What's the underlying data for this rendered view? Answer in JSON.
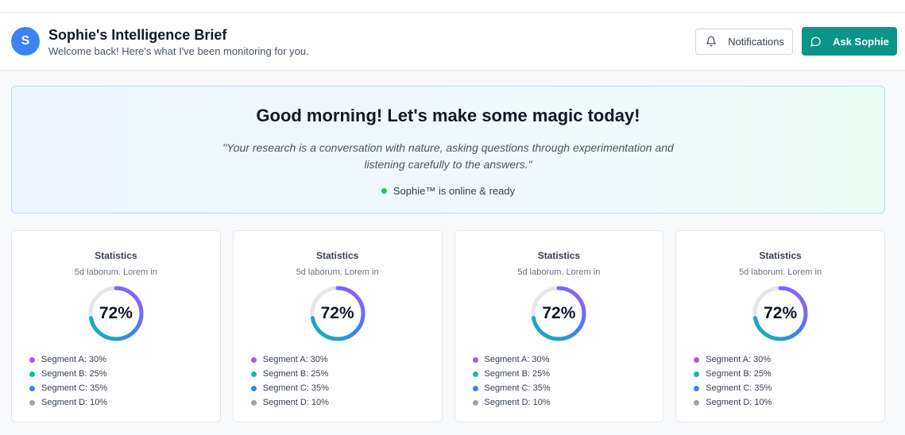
{
  "header": {
    "avatar_initial": "S",
    "title": "Sophie's Intelligence Brief",
    "subtitle": "Welcome back! Here's what I've been monitoring for you.",
    "notifications_label": "Notifications",
    "ask_label": "Ask Sophie"
  },
  "hero": {
    "title": "Good morning! Let's make some magic today!",
    "quote": "\"Your research is a conversation with nature, asking questions through experimentation and listening carefully to the answers.\"",
    "status": "Sophie™ is online & ready"
  },
  "cards": [
    {
      "title": "Statistics",
      "subtitle": "5d laborum. Lorem in",
      "value": "72%",
      "progress": 0.72,
      "legend": [
        {
          "label": "Segment A: 30%",
          "color": "#a855f7"
        },
        {
          "label": "Segment B: 25%",
          "color": "#14b8a6"
        },
        {
          "label": "Segment C: 35%",
          "color": "#3b82f6"
        },
        {
          "label": "Segment D: 10%",
          "color": "#9ca3af"
        }
      ]
    },
    {
      "title": "Statistics",
      "subtitle": "5d laborum. Lorem in",
      "value": "72%",
      "progress": 0.72,
      "legend": [
        {
          "label": "Segment A: 30%",
          "color": "#a855f7"
        },
        {
          "label": "Segment B: 25%",
          "color": "#14b8a6"
        },
        {
          "label": "Segment C: 35%",
          "color": "#3b82f6"
        },
        {
          "label": "Segment D: 10%",
          "color": "#9ca3af"
        }
      ]
    },
    {
      "title": "Statistics",
      "subtitle": "5d laborum. Lorem in",
      "value": "72%",
      "progress": 0.72,
      "legend": [
        {
          "label": "Segment A: 30%",
          "color": "#a855f7"
        },
        {
          "label": "Segment B: 25%",
          "color": "#14b8a6"
        },
        {
          "label": "Segment C: 35%",
          "color": "#3b82f6"
        },
        {
          "label": "Segment D: 10%",
          "color": "#9ca3af"
        }
      ]
    },
    {
      "title": "Statistics",
      "subtitle": "5d laborum. Lorem in",
      "value": "72%",
      "progress": 0.72,
      "legend": [
        {
          "label": "Segment A: 30%",
          "color": "#a855f7"
        },
        {
          "label": "Segment B: 25%",
          "color": "#14b8a6"
        },
        {
          "label": "Segment C: 35%",
          "color": "#3b82f6"
        },
        {
          "label": "Segment D: 10%",
          "color": "#9ca3af"
        }
      ]
    }
  ],
  "colors": {
    "accent": "#0d9488",
    "avatar": "#3b82f6",
    "online": "#22c55e",
    "gauge_start": "#14b8a6",
    "gauge_mid": "#3b82f6",
    "gauge_end": "#a855f7",
    "gauge_track": "#e5e7eb"
  },
  "icons": {
    "notifications": "bell-icon",
    "ask": "chat-bubble-icon"
  }
}
